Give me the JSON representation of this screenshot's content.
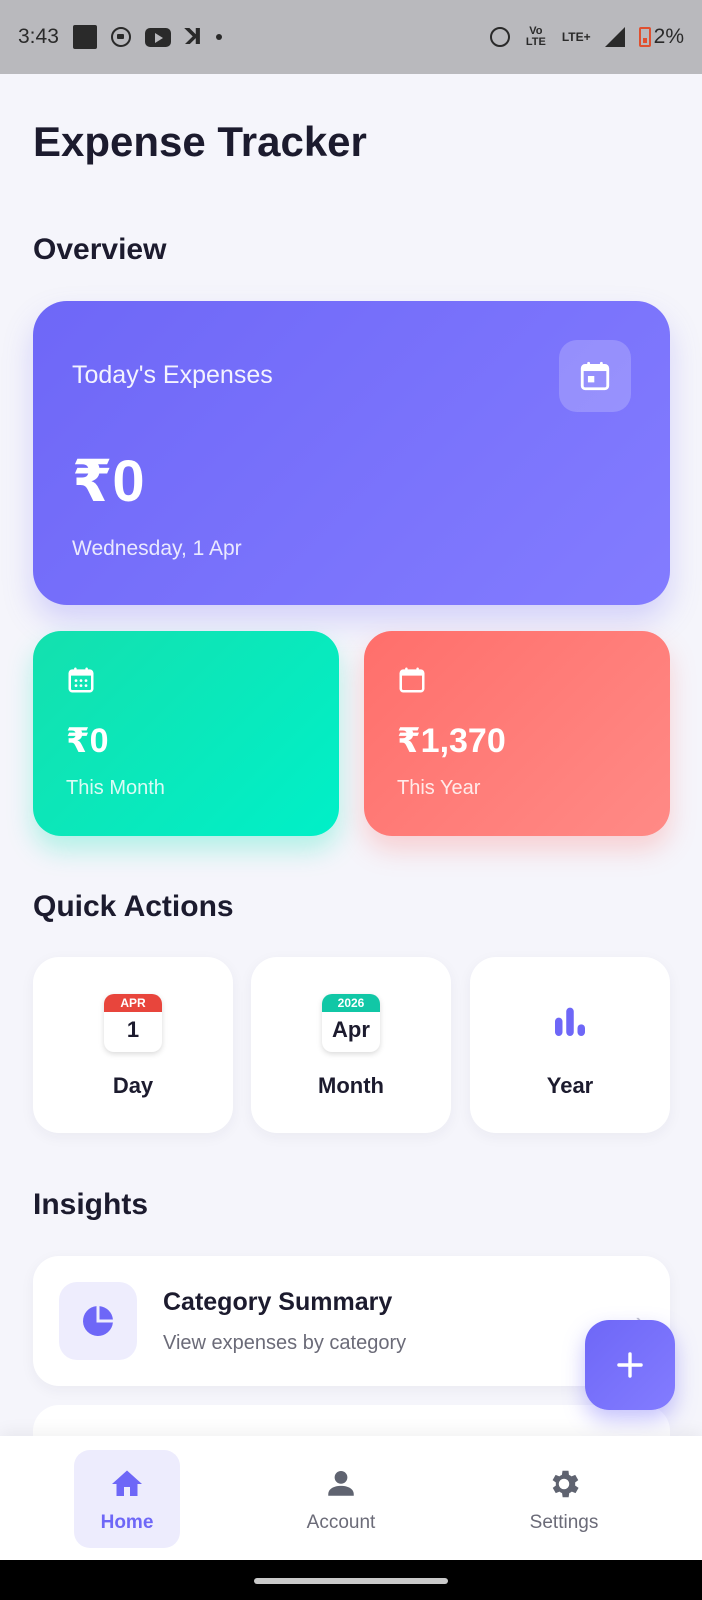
{
  "status_bar": {
    "time": "3:43",
    "lte_label": "LTE+",
    "volte_label": "Vo LTE",
    "battery": "2%"
  },
  "header": {
    "title": "Expense Tracker"
  },
  "overview": {
    "section_title": "Overview",
    "today": {
      "label": "Today's Expenses",
      "amount": "₹0",
      "date": "Wednesday, 1 Apr",
      "icon": "calendar-today-icon"
    },
    "month": {
      "amount": "₹0",
      "label": "This Month",
      "icon": "calendar-month-icon"
    },
    "year": {
      "amount": "₹1,370",
      "label": "This Year",
      "icon": "calendar-icon"
    }
  },
  "quick_actions": {
    "section_title": "Quick Actions",
    "items": [
      {
        "label": "Day",
        "cal_top": "APR",
        "cal_body": "1",
        "cal_color": "#e8453c"
      },
      {
        "label": "Month",
        "cal_top": "2026",
        "cal_body": "Apr",
        "cal_color": "#11c7a6"
      },
      {
        "label": "Year",
        "icon": "bar-chart-icon"
      }
    ]
  },
  "insights": {
    "section_title": "Insights",
    "items": [
      {
        "title": "Category Summary",
        "subtitle": "View expenses by category",
        "icon": "pie-chart-icon"
      }
    ]
  },
  "fab": {
    "icon": "plus-icon"
  },
  "bottom_nav": {
    "items": [
      {
        "label": "Home",
        "icon": "home-icon",
        "active": true
      },
      {
        "label": "Account",
        "icon": "person-icon",
        "active": false
      },
      {
        "label": "Settings",
        "icon": "gear-icon",
        "active": false
      }
    ]
  },
  "colors": {
    "primary": "#6e67f7",
    "teal": "#14e0ae",
    "coral": "#ff6f6b",
    "background": "#f5f5fb"
  }
}
